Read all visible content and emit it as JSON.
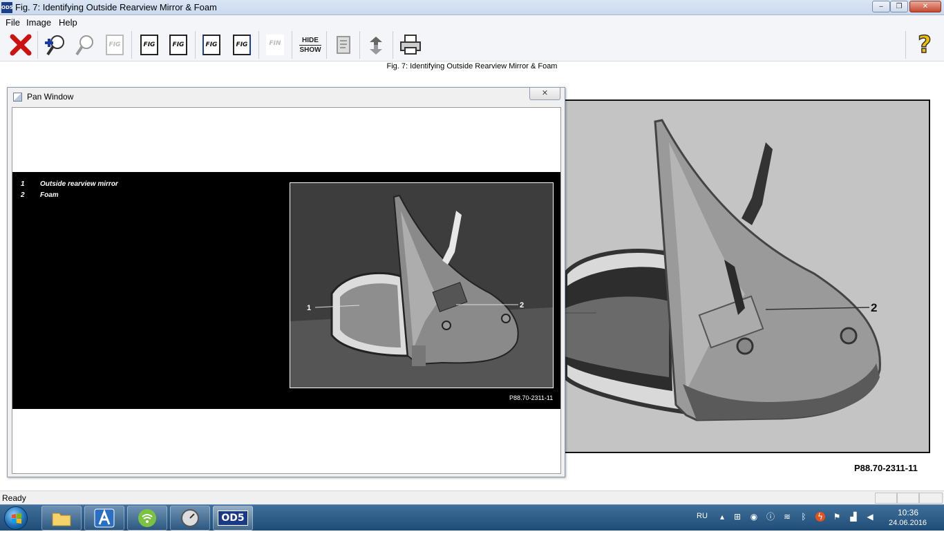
{
  "window": {
    "app_icon": "OD5",
    "title": "Fig. 7: Identifying Outside Rearview Mirror & Foam",
    "min": "‒",
    "max": "❐",
    "close": "✕"
  },
  "menu": [
    {
      "label": "File"
    },
    {
      "label": "Image"
    },
    {
      "label": "Help"
    }
  ],
  "toolbar": {
    "fig": "FIG",
    "find": "FIN",
    "hide": "HIDE",
    "show": "SHOW",
    "help": "?"
  },
  "figure": {
    "caption": "Fig. 7: Identifying Outside Rearview Mirror & Foam",
    "id": "P88.70-2311-11",
    "callout_1": "1",
    "callout_2": "2"
  },
  "pan_window": {
    "title": "Pan Window",
    "close": "✕",
    "legend": [
      {
        "num": "1",
        "text": "Outside rearview mirror"
      },
      {
        "num": "2",
        "text": "Foam"
      }
    ],
    "figure_id": "P88.70-2311-11"
  },
  "status": {
    "text": "Ready"
  },
  "taskbar": {
    "od5": "OD5",
    "lang": "RU",
    "time": "10:36",
    "date": "24.06.2016"
  },
  "colors": {
    "close_red": "#cc1111",
    "titlebar": "#c9d9ee",
    "taskbar": "#1f4d78"
  }
}
